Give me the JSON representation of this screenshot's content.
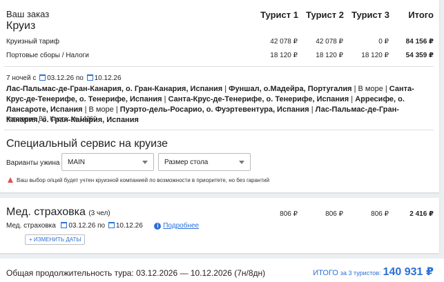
{
  "order": {
    "title": "Ваш заказ",
    "subtitle": "Круиз",
    "columns": [
      "Турист 1",
      "Турист 2",
      "Турист 3",
      "Итого"
    ],
    "rows": [
      {
        "label": "Круизный тариф",
        "values": [
          "42 078 ₽",
          "42 078 ₽",
          "0 ₽"
        ],
        "total": "84 156 ₽"
      },
      {
        "label": "Портовые сборы / Налоги",
        "values": [
          "18 120 ₽",
          "18 120 ₽",
          "18 120 ₽"
        ],
        "total": "54 359 ₽"
      }
    ]
  },
  "cruise": {
    "nights": "7 ночей с",
    "date_from": "03.12.26",
    "by": "по",
    "date_to": "10.12.26",
    "route": [
      {
        "text": "Лас-Пальмас-де-Гран-Канария, о. Гран-Канария, Испания",
        "bold": true
      },
      {
        "text": " | ",
        "bold": false
      },
      {
        "text": "Фуншал, о.Мадейра, Португалия",
        "bold": true
      },
      {
        "text": " | В море | ",
        "bold": false
      },
      {
        "text": "Санта-Крус-де-Тенерифе, о. Тенерифе, Испания",
        "bold": true
      },
      {
        "text": " | ",
        "bold": false
      },
      {
        "text": "Санта-Крус-де-Тенерифе, о. Тенерифе, Испания",
        "bold": true
      },
      {
        "text": " | ",
        "bold": false
      },
      {
        "text": "Арресифе, о. Лансароте, Испания",
        "bold": true
      },
      {
        "text": " | В море | ",
        "bold": false
      },
      {
        "text": "Пуэрто-дель-Росарио, о. Фуэртевентура, Испания",
        "bold": true
      },
      {
        "text": " | ",
        "bold": false
      },
      {
        "text": "Лас-Пальмас-де-Гран-Канария, о. Гран-Канария, Испания",
        "bold": true
      }
    ],
    "category": "Категория: В3",
    "cabin": "Каюта: № 14260"
  },
  "service": {
    "title": "Специальный сервис на круизе",
    "dinner_label": "Варианты ужина",
    "dinner_value": "MAIN",
    "table_value": "Размер стола",
    "warning": "Ваш выбор опций будет учтен круизной компанией по возможности в приоритете, но без гарантий"
  },
  "insurance": {
    "title": "Мед. страховка",
    "count": "(3 чел)",
    "values": [
      "806 ₽",
      "806 ₽",
      "806 ₽"
    ],
    "total": "2 416 ₽",
    "sub_label": "Мед. страховка",
    "date_from": "03.12.26",
    "by": "по",
    "date_to": "10.12.26",
    "more_link": "Подробнее",
    "change_dates": "ИЗМЕНИТЬ ДАТЫ"
  },
  "summary": {
    "duration": "Общая продолжительность тура: 03.12.2026 — 10.12.2026 (7н/8дн)",
    "total_label": "ИТОГО",
    "for_label": "за 3 туристов:",
    "total_value": "140 931 ₽"
  },
  "colors": {
    "accent": "#2b6fd6",
    "warning": "#e05050"
  }
}
